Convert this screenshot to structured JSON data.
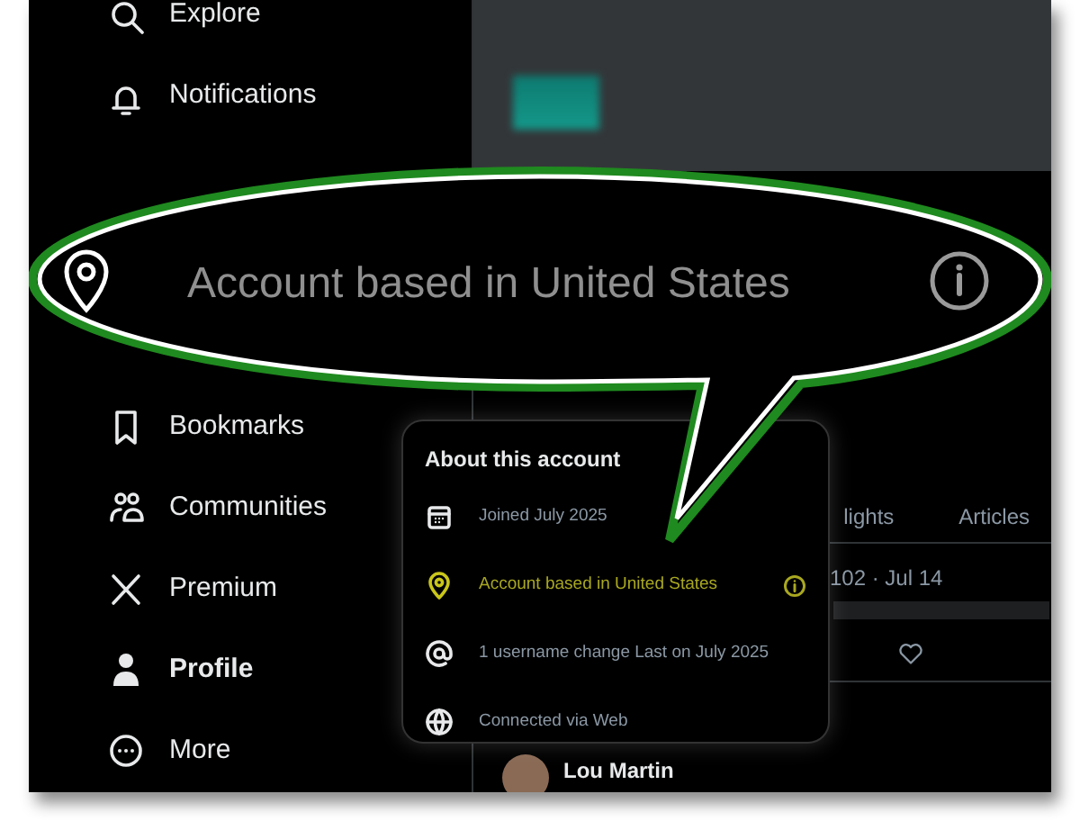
{
  "sidebar": {
    "items": [
      {
        "label": "Explore",
        "selected": false
      },
      {
        "label": "Notifications",
        "selected": false
      },
      {
        "label": "Bookmarks",
        "selected": false
      },
      {
        "label": "Communities",
        "selected": false
      },
      {
        "label": "Premium",
        "selected": false
      },
      {
        "label": "Profile",
        "selected": true
      },
      {
        "label": "More",
        "selected": false
      }
    ]
  },
  "profile": {
    "tabs": [
      {
        "label": "lights"
      },
      {
        "label": "Articles"
      }
    ],
    "post": {
      "meta": "102 · Jul 14"
    },
    "next_post": {
      "author": "Lou Martin"
    }
  },
  "about_popup": {
    "title": "About this account",
    "rows": [
      {
        "kind": "joined",
        "text": "Joined July 2025",
        "highlighted": false
      },
      {
        "kind": "location",
        "text": "Account based in United States",
        "highlighted": true
      },
      {
        "kind": "username",
        "text": "1 username change Last on July 2025",
        "highlighted": false
      },
      {
        "kind": "connection",
        "text": "Connected via Web",
        "highlighted": false
      }
    ]
  },
  "callout": {
    "text": "Account based in United States"
  }
}
